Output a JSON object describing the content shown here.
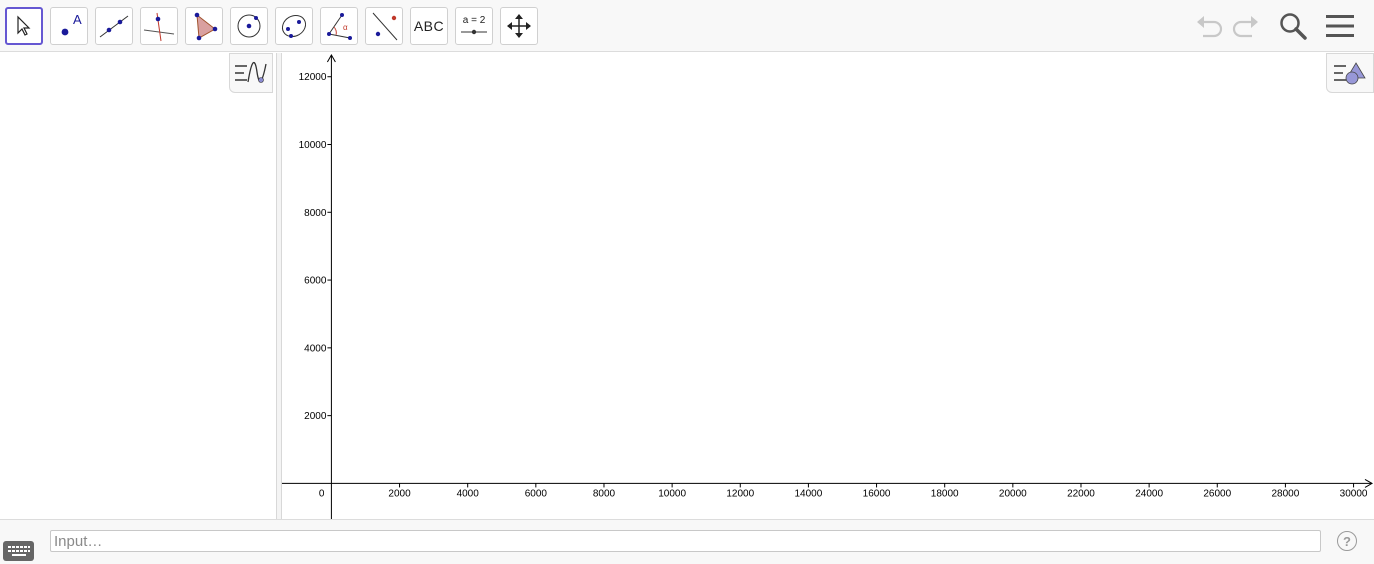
{
  "toolbar": {
    "tools": [
      {
        "name": "move",
        "label": ""
      },
      {
        "name": "point",
        "label": "A"
      },
      {
        "name": "line",
        "label": ""
      },
      {
        "name": "perpendicular-line",
        "label": ""
      },
      {
        "name": "polygon",
        "label": ""
      },
      {
        "name": "circle-center-point",
        "label": ""
      },
      {
        "name": "ellipse",
        "label": ""
      },
      {
        "name": "angle",
        "label": "α"
      },
      {
        "name": "reflect-about-line",
        "label": ""
      },
      {
        "name": "text",
        "label": "ABC"
      },
      {
        "name": "slider",
        "label": "a = 2"
      },
      {
        "name": "move-graphics-view",
        "label": ""
      }
    ],
    "selected_tool": "move",
    "right": [
      "undo-icon",
      "redo-icon",
      "search-icon",
      "menu-icon"
    ]
  },
  "algebra_view": {
    "style_bar_icon": "algebra-style-icon"
  },
  "graphics_view": {
    "style_bar_icon": "graphics-style-icon"
  },
  "chart_data": {
    "type": "scatter",
    "series": [],
    "x_ticks": [
      2000,
      4000,
      6000,
      8000,
      10000,
      12000,
      14000,
      16000,
      18000,
      20000,
      22000,
      24000,
      26000,
      28000,
      30000
    ],
    "y_ticks": [
      2000,
      4000,
      6000,
      8000,
      10000,
      12000
    ],
    "origin_label": "0",
    "xlim": [
      -1450,
      30600
    ],
    "ylim": [
      -1050,
      12700
    ],
    "grid": false
  },
  "input_bar": {
    "placeholder": "Input…",
    "value": "",
    "help_label": "?"
  },
  "colors": {
    "accent": "#6557d2",
    "point": "#1a1a9a",
    "polygon_fill": "#d9a0a0"
  }
}
